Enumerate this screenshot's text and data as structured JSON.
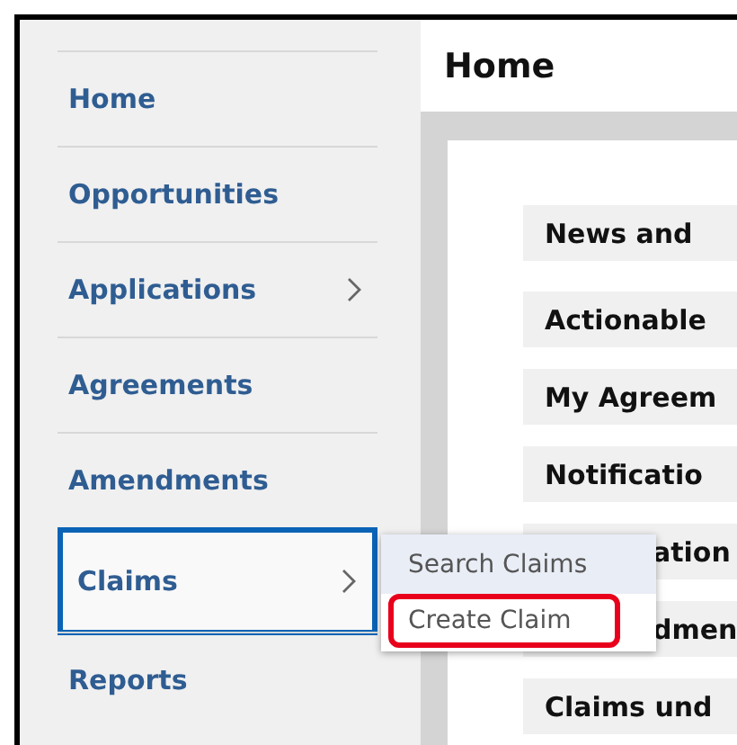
{
  "sidebar": {
    "items": [
      {
        "label": "Home",
        "selected": false,
        "has_submenu": false
      },
      {
        "label": "Opportunities",
        "selected": false,
        "has_submenu": false
      },
      {
        "label": "Applications",
        "selected": false,
        "has_submenu": true
      },
      {
        "label": "Agreements",
        "selected": false,
        "has_submenu": false
      },
      {
        "label": "Amendments",
        "selected": false,
        "has_submenu": false
      },
      {
        "label": "Claims",
        "selected": true,
        "has_submenu": true
      },
      {
        "label": "Reports",
        "selected": false,
        "has_submenu": false
      }
    ]
  },
  "submenu": {
    "items": [
      {
        "label": "Search Claims",
        "hovered": true,
        "outlined": false
      },
      {
        "label": "Create Claim",
        "hovered": false,
        "outlined": true
      }
    ]
  },
  "page": {
    "title": "Home",
    "sections": [
      {
        "label": "News and"
      },
      {
        "label": "Actionable"
      },
      {
        "label": "My Agreem"
      },
      {
        "label": "Notificatio"
      },
      {
        "label": "ation",
        "covered": true
      },
      {
        "label": "dmen",
        "covered": true
      },
      {
        "label": "Claims und"
      }
    ]
  }
}
